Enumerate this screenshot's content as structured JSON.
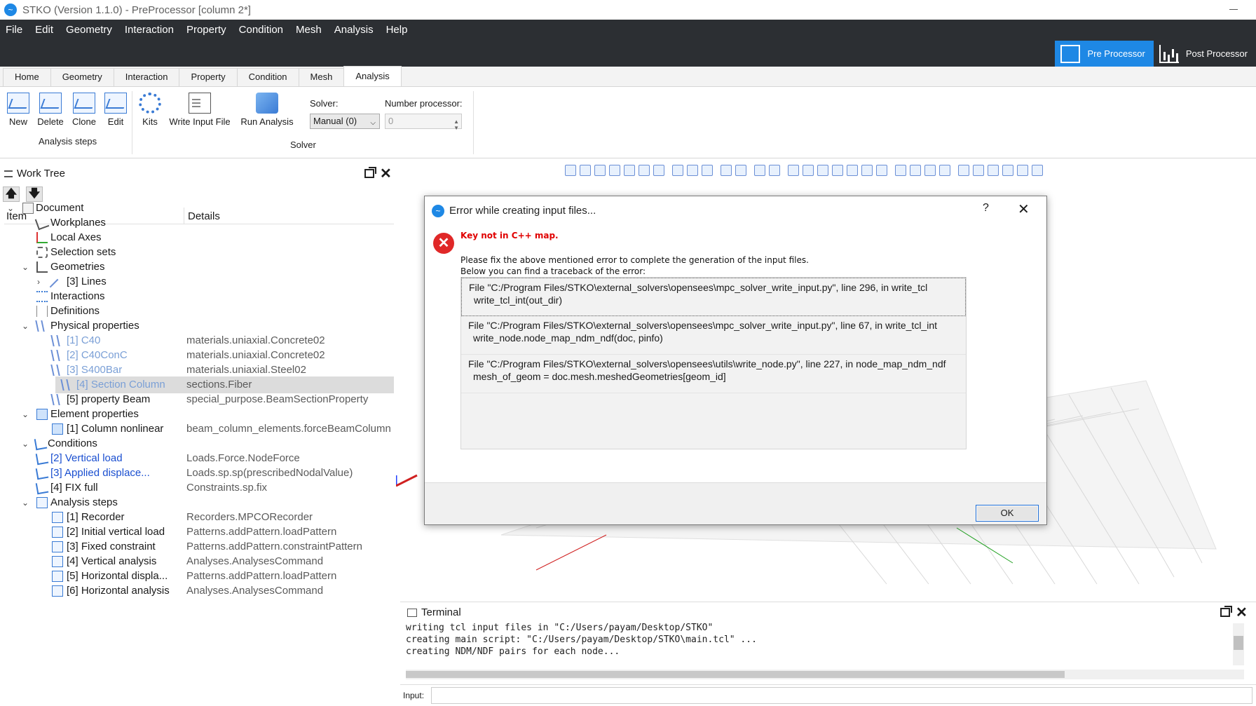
{
  "window": {
    "title": "STKO (Version 1.1.0) - PreProcessor [column 2*]"
  },
  "menu": [
    "File",
    "Edit",
    "Geometry",
    "Interaction",
    "Property",
    "Condition",
    "Mesh",
    "Analysis",
    "Help"
  ],
  "modes": {
    "pre": "Pre Processor",
    "post": "Post Processor"
  },
  "ribbon_tabs": [
    "Home",
    "Geometry",
    "Interaction",
    "Property",
    "Condition",
    "Mesh",
    "Analysis"
  ],
  "ribbon": {
    "analysis_steps": {
      "new": "New",
      "delete": "Delete",
      "clone": "Clone",
      "edit": "Edit",
      "group_label": "Analysis steps"
    },
    "solver_group": {
      "kits": "Kits",
      "write_input": "Write Input File",
      "run_analysis": "Run Analysis",
      "solver_label": "Solver:",
      "solver_value": "Manual (0)",
      "nproc_label": "Number processor:",
      "nproc_value": "0",
      "group_label": "Solver"
    }
  },
  "worktree": {
    "title": "Work Tree",
    "col_item": "Item",
    "col_details": "Details",
    "rows": [
      {
        "label": "Document",
        "details": ""
      },
      {
        "label": "Workplanes",
        "details": ""
      },
      {
        "label": "Local Axes",
        "details": ""
      },
      {
        "label": "Selection sets",
        "details": ""
      },
      {
        "label": "Geometries",
        "details": ""
      },
      {
        "label": "[3] Lines",
        "details": ""
      },
      {
        "label": "Interactions",
        "details": ""
      },
      {
        "label": "Definitions",
        "details": ""
      },
      {
        "label": "Physical properties",
        "details": ""
      },
      {
        "label": "[1] C40",
        "details": "materials.uniaxial.Concrete02"
      },
      {
        "label": "[2] C40ConC",
        "details": "materials.uniaxial.Concrete02"
      },
      {
        "label": "[3] S400Bar",
        "details": "materials.uniaxial.Steel02"
      },
      {
        "label": "[4] Section Column",
        "details": "sections.Fiber"
      },
      {
        "label": "[5] property Beam",
        "details": "special_purpose.BeamSectionProperty"
      },
      {
        "label": "Element properties",
        "details": ""
      },
      {
        "label": "[1] Column nonlinear",
        "details": "beam_column_elements.forceBeamColumn"
      },
      {
        "label": "Conditions",
        "details": ""
      },
      {
        "label": "[2] Vertical load",
        "details": "Loads.Force.NodeForce"
      },
      {
        "label": "[3] Applied displace...",
        "details": "Loads.sp.sp(prescribedNodalValue)"
      },
      {
        "label": "[4] FIX full",
        "details": "Constraints.sp.fix"
      },
      {
        "label": "Analysis steps",
        "details": ""
      },
      {
        "label": "[1] Recorder",
        "details": "Recorders.MPCORecorder"
      },
      {
        "label": "[2] Initial vertical load",
        "details": "Patterns.addPattern.loadPattern"
      },
      {
        "label": "[3] Fixed constraint",
        "details": "Patterns.addPattern.constraintPattern"
      },
      {
        "label": "[4] Vertical analysis",
        "details": "Analyses.AnalysesCommand"
      },
      {
        "label": "[5] Horizontal displa...",
        "details": "Patterns.addPattern.loadPattern"
      },
      {
        "label": "[6] Horizontal analysis",
        "details": "Analyses.AnalysesCommand"
      }
    ]
  },
  "dialog": {
    "title": "Error while creating input files...",
    "help": "?",
    "error_message": "Key not in C++ map.",
    "info_line1": "Please fix the above mentioned error to complete the generation of the input files.",
    "info_line2": "Below you can find a traceback of the error:",
    "traceback": [
      {
        "line1": "File \"C:/Program Files/STKO\\external_solvers\\opensees\\mpc_solver_write_input.py\", line 296, in write_tcl",
        "line2": "write_tcl_int(out_dir)"
      },
      {
        "line1": "File \"C:/Program Files/STKO\\external_solvers\\opensees\\mpc_solver_write_input.py\", line 67, in write_tcl_int",
        "line2": "write_node.node_map_ndm_ndf(doc, pinfo)"
      },
      {
        "line1": "File \"C:/Program Files/STKO\\external_solvers\\opensees\\utils\\write_node.py\", line 227, in node_map_ndm_ndf",
        "line2": "mesh_of_geom = doc.mesh.meshedGeometries[geom_id]"
      }
    ],
    "ok": "OK"
  },
  "terminal": {
    "title": "Terminal",
    "lines": [
      "writing tcl input files in \"C:/Users/payam/Desktop/STKO\"",
      "creating main script: \"C:/Users/payam/Desktop/STKO\\main.tcl\" ...",
      "creating NDM/NDF pairs for each node..."
    ],
    "input_label": "Input:"
  },
  "colors": {
    "accent": "#1e88e5",
    "menubar": "#2c2f33",
    "error": "#e00000"
  }
}
